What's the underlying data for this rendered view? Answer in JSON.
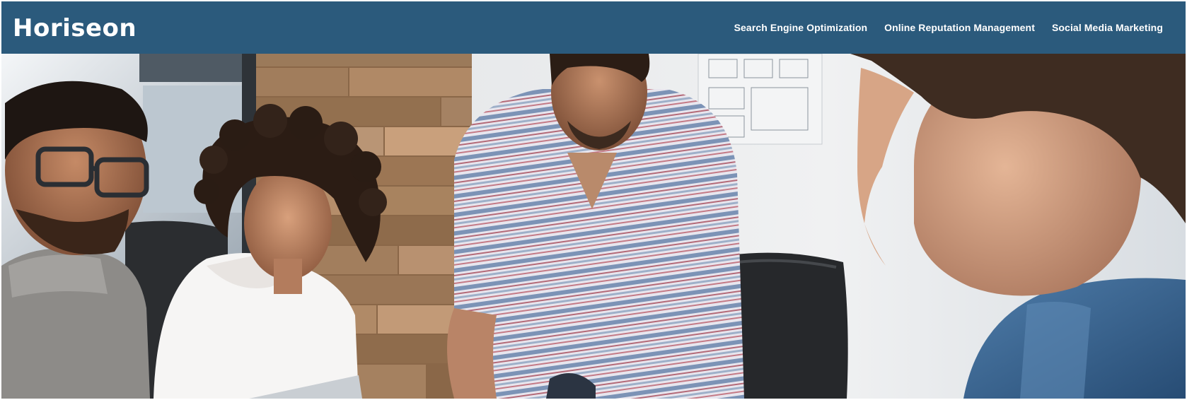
{
  "header": {
    "logo_text": "Horiseon",
    "nav": [
      {
        "label": "Search Engine Optimization"
      },
      {
        "label": "Online Reputation Management"
      },
      {
        "label": "Social Media Marketing"
      }
    ]
  },
  "hero": {
    "image_name": "hero-team-meeting-image"
  },
  "colors": {
    "header_bg": "#2b5a7c",
    "header_text": "#ffffff"
  }
}
